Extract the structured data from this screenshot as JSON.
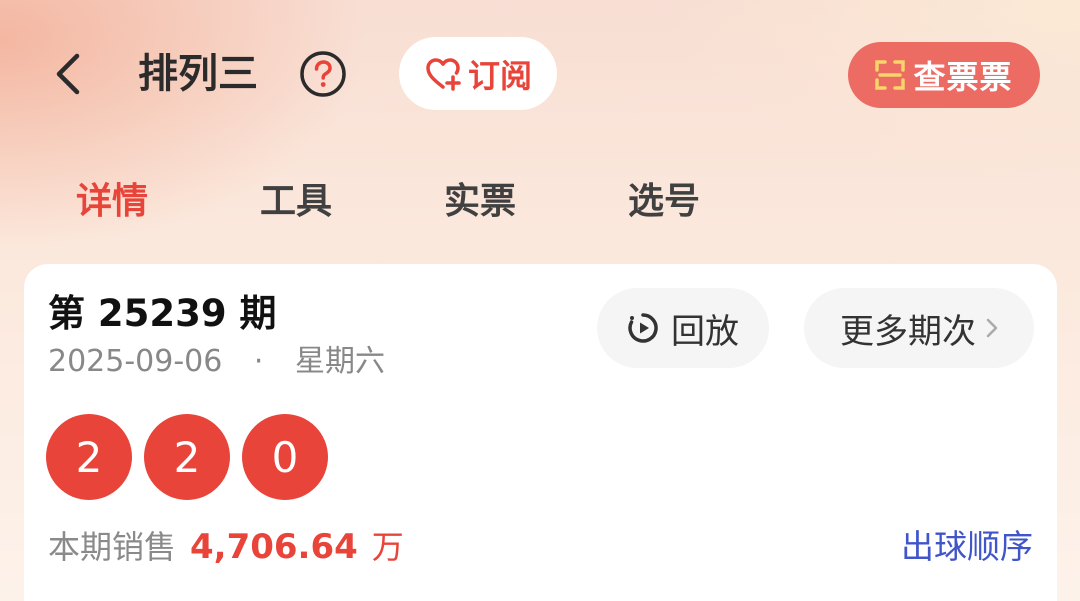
{
  "header": {
    "title": "排列三",
    "subscribe_label": "订阅",
    "check_ticket_label": "查票票"
  },
  "tabs": [
    {
      "label": "详情",
      "active": true
    },
    {
      "label": "工具",
      "active": false
    },
    {
      "label": "实票",
      "active": false
    },
    {
      "label": "选号",
      "active": false
    }
  ],
  "draw": {
    "issue_title": "第 25239 期",
    "date": "2025-09-06",
    "separator": "·",
    "weekday": "星期六",
    "replay_label": "回放",
    "more_issues_label": "更多期次",
    "balls": [
      "2",
      "2",
      "0"
    ],
    "sales_label": "本期销售",
    "sales_amount": "4,706.64",
    "sales_unit": "万",
    "ball_order_label": "出球顺序"
  },
  "colors": {
    "accent": "#e8443a",
    "check_button": "#ec6b63",
    "link": "#3f55c9"
  },
  "icons": {
    "back": "chevron-left-icon",
    "help": "question-circle-icon",
    "subscribe": "heart-plus-icon",
    "scan": "scan-icon",
    "replay": "replay-icon",
    "more": "chevron-right-icon"
  }
}
